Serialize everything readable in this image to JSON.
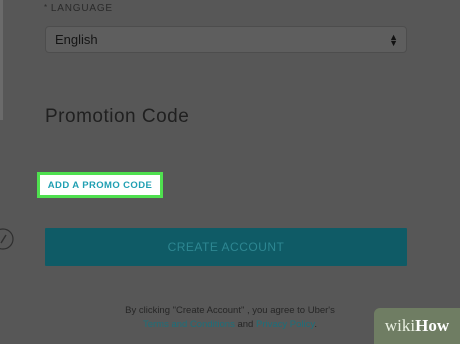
{
  "language": {
    "required_mark": "*",
    "label": "LANGUAGE",
    "selected": "English"
  },
  "promotion": {
    "title": "Promotion Code",
    "link_label": "ADD A PROMO CODE"
  },
  "actions": {
    "create_account_label": "CREATE ACCOUNT"
  },
  "terms": {
    "line1": "By clicking \"Create Account\" , you agree to Uber's",
    "terms_link": "Terms and Conditions",
    "and_text": " and ",
    "privacy_link": "Privacy Policy",
    "end": "."
  },
  "watermark": {
    "wiki": "wiki",
    "how": "How"
  },
  "colors": {
    "overlay": "#575757",
    "highlight": "#4fe04f",
    "accent": "#1f9fb2",
    "button": "#0f5b66"
  }
}
